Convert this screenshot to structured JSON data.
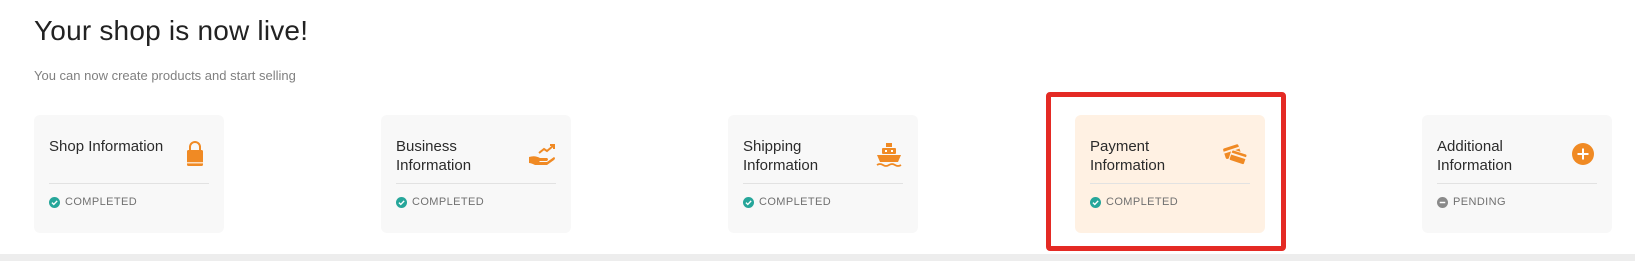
{
  "header": {
    "title": "Your shop is now live!",
    "subtitle": "You can now create products and start selling"
  },
  "colors": {
    "accent": "#f08a24",
    "completed": "#26a69a",
    "pending": "#8a8a8a",
    "highlight_bg": "#fff1e3",
    "annotation": "#e42a24"
  },
  "cards": [
    {
      "label": "Shop Information",
      "status": "COMPLETED",
      "icon": "shopping-bag-icon"
    },
    {
      "label": "Business Information",
      "status": "COMPLETED",
      "icon": "handshake-growth-icon"
    },
    {
      "label": "Shipping Information",
      "status": "COMPLETED",
      "icon": "ship-icon"
    },
    {
      "label": "Payment Information",
      "status": "COMPLETED",
      "icon": "credit-card-icon"
    },
    {
      "label": "Additional Information",
      "status": "PENDING",
      "icon": "plus-circle-icon"
    }
  ]
}
